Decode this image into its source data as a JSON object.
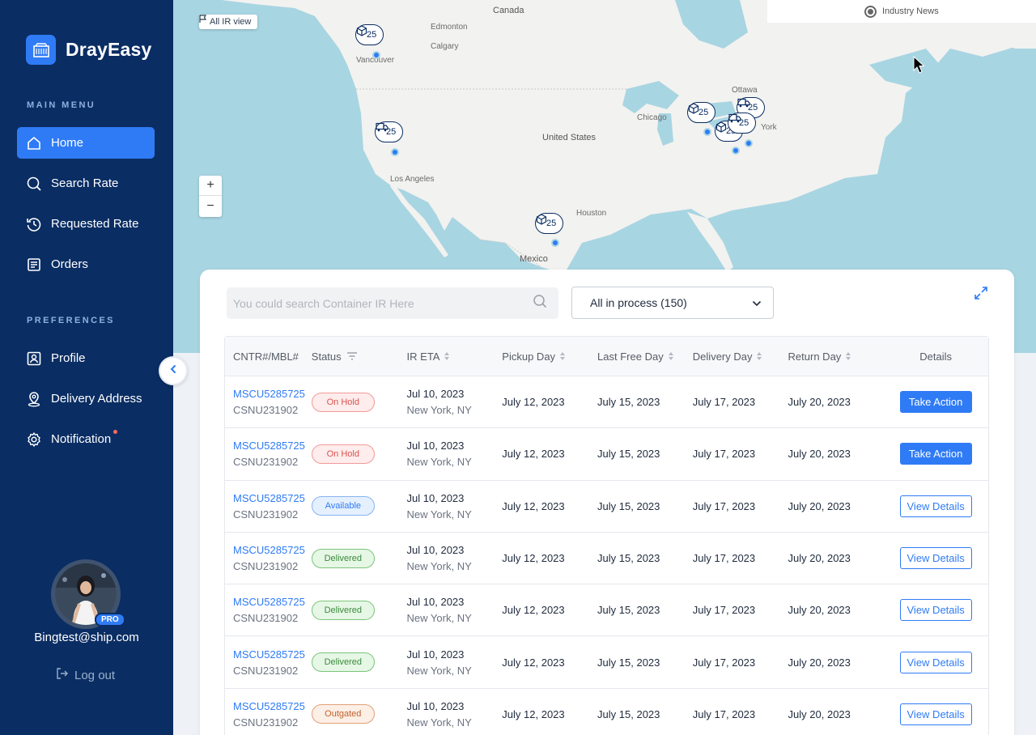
{
  "app": {
    "name": "DrayEasy"
  },
  "sidebar": {
    "main_menu_label": "MAIN MENU",
    "preferences_label": "PREFERENCES",
    "main_items": [
      {
        "label": "Home",
        "icon": "home-icon",
        "active": true
      },
      {
        "label": "Search Rate",
        "icon": "search-icon"
      },
      {
        "label": "Requested Rate",
        "icon": "history-icon"
      },
      {
        "label": "Orders",
        "icon": "orders-icon"
      }
    ],
    "pref_items": [
      {
        "label": "Profile",
        "icon": "profile-icon"
      },
      {
        "label": "Delivery Address",
        "icon": "location-pin-icon"
      },
      {
        "label": "Notification",
        "icon": "gear-icon"
      }
    ],
    "user_email": "Bingtest@ship.com",
    "pro_badge": "PRO",
    "logout_label": "Log out"
  },
  "map": {
    "ir_view_label": "All IR view",
    "industry_news_label": "Industry News",
    "labels": {
      "canada": "Canada",
      "edmonton": "Edmonton",
      "calgary": "Calgary",
      "vancouver": "Vancouver",
      "united_states": "United States",
      "los_angeles": "Los Angeles",
      "chicago": "Chicago",
      "ottawa": "Ottawa",
      "houston": "Houston",
      "mexico": "Mexico",
      "new_york_partial": "York"
    },
    "markers": [
      {
        "count": "25",
        "icon": "package-icon"
      },
      {
        "count": "25",
        "icon": "truck-icon"
      },
      {
        "count": "25",
        "icon": "package-icon"
      },
      {
        "count": "25",
        "icon": "package-icon"
      },
      {
        "count": "25",
        "icon": "truck-icon"
      },
      {
        "count": "25",
        "icon": "package-icon"
      },
      {
        "count": "25",
        "icon": "truck-icon"
      }
    ]
  },
  "panel": {
    "search_placeholder": "You could search Container IR Here",
    "filter_value": "All in process (150)",
    "columns": [
      "CNTR#/MBL#",
      "Status",
      "IR ETA",
      "Pickup Day",
      "Last Free Day",
      "Delivery Day",
      "Return Day",
      "Details"
    ],
    "rows": [
      {
        "cntr": "MSCU5285725",
        "mbl": "CSNU231902",
        "status": "On Hold",
        "eta": "Jul 10, 2023",
        "loc": "New York, NY",
        "pickup": "July 12, 2023",
        "lfd": "July 15, 2023",
        "delivery": "July 17, 2023",
        "return": "July 20, 2023",
        "action": "Take Action"
      },
      {
        "cntr": "MSCU5285725",
        "mbl": "CSNU231902",
        "status": "On Hold",
        "eta": "Jul 10, 2023",
        "loc": "New York, NY",
        "pickup": "July 12, 2023",
        "lfd": "July 15, 2023",
        "delivery": "July 17, 2023",
        "return": "July 20, 2023",
        "action": "Take Action"
      },
      {
        "cntr": "MSCU5285725",
        "mbl": "CSNU231902",
        "status": "Available",
        "eta": "Jul 10, 2023",
        "loc": "New York, NY",
        "pickup": "July 12, 2023",
        "lfd": "July 15, 2023",
        "delivery": "July 17, 2023",
        "return": "July 20, 2023",
        "action": "View Details"
      },
      {
        "cntr": "MSCU5285725",
        "mbl": "CSNU231902",
        "status": "Delivered",
        "eta": "Jul 10, 2023",
        "loc": "New York, NY",
        "pickup": "July 12, 2023",
        "lfd": "July 15, 2023",
        "delivery": "July 17, 2023",
        "return": "July 20, 2023",
        "action": "View Details"
      },
      {
        "cntr": "MSCU5285725",
        "mbl": "CSNU231902",
        "status": "Delivered",
        "eta": "Jul 10, 2023",
        "loc": "New York, NY",
        "pickup": "July 12, 2023",
        "lfd": "July 15, 2023",
        "delivery": "July 17, 2023",
        "return": "July 20, 2023",
        "action": "View Details"
      },
      {
        "cntr": "MSCU5285725",
        "mbl": "CSNU231902",
        "status": "Delivered",
        "eta": "Jul 10, 2023",
        "loc": "New York, NY",
        "pickup": "July 12, 2023",
        "lfd": "July 15, 2023",
        "delivery": "July 17, 2023",
        "return": "July 20, 2023",
        "action": "View Details"
      },
      {
        "cntr": "MSCU5285725",
        "mbl": "CSNU231902",
        "status": "Outgated",
        "eta": "Jul 10, 2023",
        "loc": "New York, NY",
        "pickup": "July 12, 2023",
        "lfd": "July 15, 2023",
        "delivery": "July 17, 2023",
        "return": "July 20, 2023",
        "action": "View Details"
      }
    ]
  },
  "colors": {
    "sidebar": "#0a2d63",
    "accent": "#2f7bf5",
    "water": "#a8d5e2",
    "land": "#f2f2f0"
  }
}
